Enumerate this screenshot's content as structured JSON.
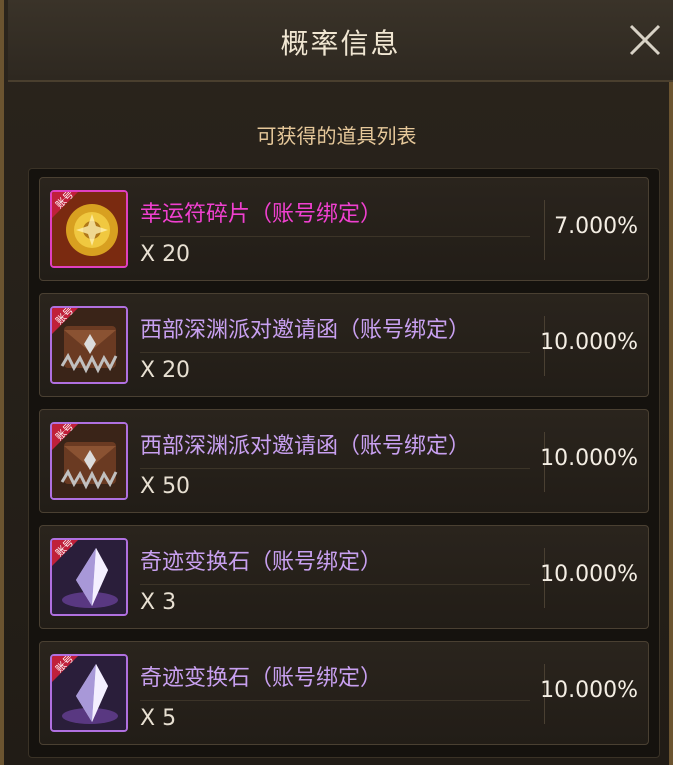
{
  "dialog": {
    "title": "概率信息",
    "subtitle": "可获得的道具列表"
  },
  "items": [
    {
      "name": "幸运符碎片（账号绑定）",
      "qty": "X 20",
      "prob": "7.000%",
      "icon": "lucky-charm-fragment-icon",
      "badge": "账号",
      "rarity_color": "#e040c0"
    },
    {
      "name": "西部深渊派对邀请函（账号绑定）",
      "qty": "X 20",
      "prob": "10.000%",
      "icon": "abyss-party-invitation-icon",
      "badge": "账号",
      "rarity_color": "#b070e0"
    },
    {
      "name": "西部深渊派对邀请函（账号绑定）",
      "qty": "X 50",
      "prob": "10.000%",
      "icon": "abyss-party-invitation-icon",
      "badge": "账号",
      "rarity_color": "#b070e0"
    },
    {
      "name": "奇迹变换石（账号绑定）",
      "qty": "X 3",
      "prob": "10.000%",
      "icon": "miracle-transform-stone-icon",
      "badge": "账号",
      "rarity_color": "#b070e0"
    },
    {
      "name": "奇迹变换石（账号绑定）",
      "qty": "X 5",
      "prob": "10.000%",
      "icon": "miracle-transform-stone-icon",
      "badge": "账号",
      "rarity_color": "#b070e0"
    }
  ]
}
